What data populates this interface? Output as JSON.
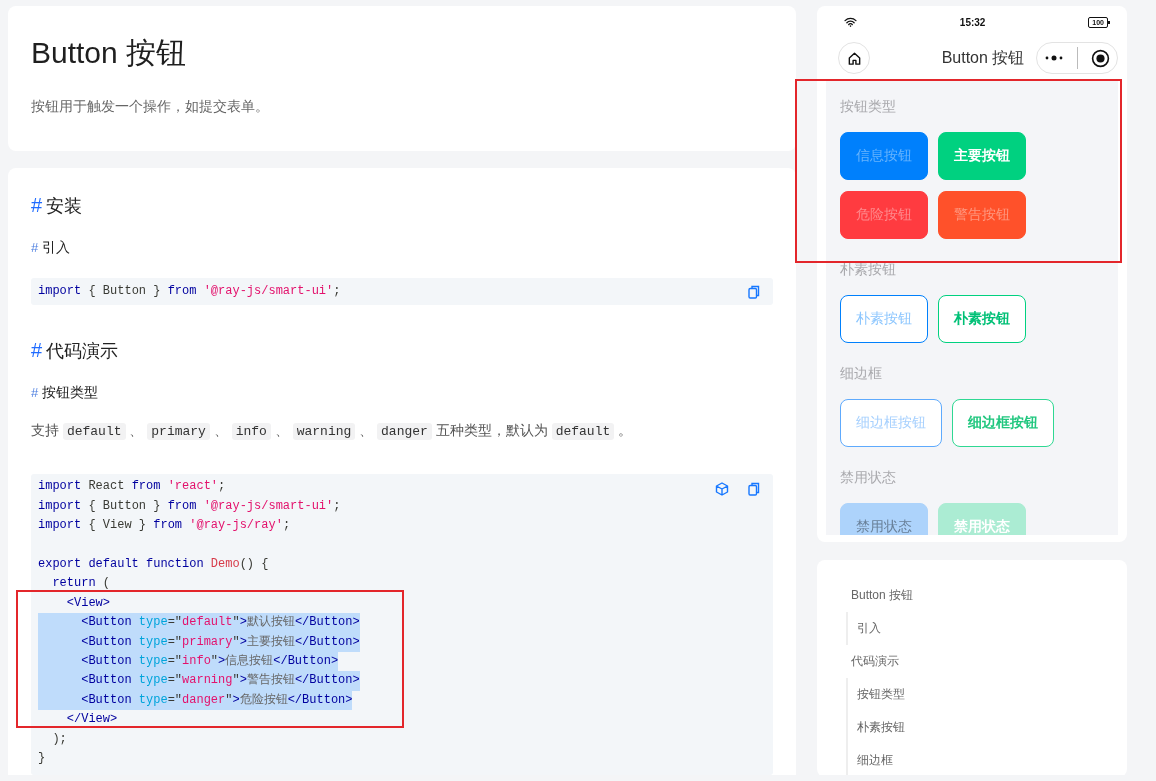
{
  "doc": {
    "title": "Button 按钮",
    "description": "按钮用于触发一个操作，如提交表单。"
  },
  "content": [
    {
      "kind": "h2",
      "anchor": "#",
      "text": "安装"
    },
    {
      "kind": "h3",
      "anchor": "#",
      "text": "引入"
    },
    {
      "kind": "code",
      "actions": [
        {
          "kind": "copy"
        }
      ],
      "lines": [
        {
          "kind": "code",
          "highlighted": false,
          "tokens": [
            {
              "kind": "keyword",
              "text": "import"
            },
            {
              "kind": "plain",
              "text": " { Button } "
            },
            {
              "kind": "keyword",
              "text": "from"
            },
            {
              "kind": "string",
              "text": " '@ray-js/smart-ui'"
            },
            {
              "kind": "plain",
              "text": ";"
            }
          ]
        }
      ]
    },
    {
      "kind": "h2",
      "anchor": "#",
      "text": "代码演示"
    },
    {
      "kind": "h3",
      "anchor": "#",
      "text": "按钮类型"
    },
    {
      "kind": "paragraph",
      "segments": [
        {
          "kind": "text",
          "text": "支持 "
        },
        {
          "kind": "code",
          "text": "default"
        },
        {
          "kind": "text",
          "text": " 、 "
        },
        {
          "kind": "code",
          "text": "primary"
        },
        {
          "kind": "text",
          "text": " 、 "
        },
        {
          "kind": "code",
          "text": "info"
        },
        {
          "kind": "text",
          "text": " 、 "
        },
        {
          "kind": "code",
          "text": "warning"
        },
        {
          "kind": "text",
          "text": " 、 "
        },
        {
          "kind": "code",
          "text": "danger"
        },
        {
          "kind": "text",
          "text": " 五种类型，默认为 "
        },
        {
          "kind": "code",
          "text": "default"
        },
        {
          "kind": "text",
          "text": " 。"
        }
      ]
    },
    {
      "kind": "code",
      "actions": [
        {
          "kind": "sandbox"
        },
        {
          "kind": "copy"
        }
      ],
      "lines": [
        {
          "kind": "code",
          "highlighted": false,
          "tokens": [
            {
              "kind": "keyword",
              "text": "import"
            },
            {
              "kind": "plain",
              "text": " React "
            },
            {
              "kind": "keyword",
              "text": "from"
            },
            {
              "kind": "string",
              "text": " 'react'"
            },
            {
              "kind": "plain",
              "text": ";"
            }
          ]
        },
        {
          "kind": "code",
          "highlighted": false,
          "tokens": [
            {
              "kind": "keyword",
              "text": "import"
            },
            {
              "kind": "plain",
              "text": " { Button } "
            },
            {
              "kind": "keyword",
              "text": "from"
            },
            {
              "kind": "string",
              "text": " '@ray-js/smart-ui'"
            },
            {
              "kind": "plain",
              "text": ";"
            }
          ]
        },
        {
          "kind": "code",
          "highlighted": false,
          "tokens": [
            {
              "kind": "keyword",
              "text": "import"
            },
            {
              "kind": "plain",
              "text": " { View } "
            },
            {
              "kind": "keyword",
              "text": "from"
            },
            {
              "kind": "string",
              "text": " '@ray-js/ray'"
            },
            {
              "kind": "plain",
              "text": ";"
            }
          ]
        },
        {
          "kind": "blank",
          "highlighted": false
        },
        {
          "kind": "code",
          "highlighted": false,
          "tokens": [
            {
              "kind": "keyword",
              "text": "export default function"
            },
            {
              "kind": "func",
              "text": " Demo"
            },
            {
              "kind": "plain",
              "text": "() {"
            }
          ]
        },
        {
          "kind": "code",
          "highlighted": false,
          "tokens": [
            {
              "kind": "keyword",
              "text": "  return"
            },
            {
              "kind": "plain",
              "text": " ("
            }
          ]
        },
        {
          "kind": "code",
          "highlighted": false,
          "tokens": [
            {
              "kind": "tag",
              "text": "    <View>"
            }
          ]
        },
        {
          "kind": "code",
          "highlighted": true,
          "tokens": [
            {
              "kind": "tag",
              "text": "      <Button"
            },
            {
              "kind": "attr",
              "text": " type"
            },
            {
              "kind": "plain",
              "text": "=\""
            },
            {
              "kind": "string",
              "text": "default"
            },
            {
              "kind": "plain",
              "text": "\""
            },
            {
              "kind": "tag",
              "text": ">"
            },
            {
              "kind": "cjk",
              "text": "默认按钮"
            },
            {
              "kind": "tag",
              "text": "</Button>"
            }
          ]
        },
        {
          "kind": "code",
          "highlighted": true,
          "tokens": [
            {
              "kind": "tag",
              "text": "      <Button"
            },
            {
              "kind": "attr",
              "text": " type"
            },
            {
              "kind": "plain",
              "text": "=\""
            },
            {
              "kind": "string",
              "text": "primary"
            },
            {
              "kind": "plain",
              "text": "\""
            },
            {
              "kind": "tag",
              "text": ">"
            },
            {
              "kind": "cjk",
              "text": "主要按钮"
            },
            {
              "kind": "tag",
              "text": "</Button>"
            }
          ]
        },
        {
          "kind": "code",
          "highlighted": true,
          "tokens": [
            {
              "kind": "tag",
              "text": "      <Button"
            },
            {
              "kind": "attr",
              "text": " type"
            },
            {
              "kind": "plain",
              "text": "=\""
            },
            {
              "kind": "string",
              "text": "info"
            },
            {
              "kind": "plain",
              "text": "\""
            },
            {
              "kind": "tag",
              "text": ">"
            },
            {
              "kind": "cjk",
              "text": "信息按钮"
            },
            {
              "kind": "tag",
              "text": "</Button>"
            }
          ]
        },
        {
          "kind": "code",
          "highlighted": true,
          "tokens": [
            {
              "kind": "tag",
              "text": "      <Button"
            },
            {
              "kind": "attr",
              "text": " type"
            },
            {
              "kind": "plain",
              "text": "=\""
            },
            {
              "kind": "string",
              "text": "warning"
            },
            {
              "kind": "plain",
              "text": "\""
            },
            {
              "kind": "tag",
              "text": ">"
            },
            {
              "kind": "cjk",
              "text": "警告按钮"
            },
            {
              "kind": "tag",
              "text": "</Button>"
            }
          ]
        },
        {
          "kind": "code",
          "highlighted": true,
          "tokens": [
            {
              "kind": "tag",
              "text": "      <Button"
            },
            {
              "kind": "attr",
              "text": " type"
            },
            {
              "kind": "plain",
              "text": "=\""
            },
            {
              "kind": "string",
              "text": "danger"
            },
            {
              "kind": "plain",
              "text": "\""
            },
            {
              "kind": "tag",
              "text": ">"
            },
            {
              "kind": "cjk",
              "text": "危险按钮"
            },
            {
              "kind": "tag",
              "text": "</Button>"
            }
          ]
        },
        {
          "kind": "code",
          "highlighted": false,
          "tokens": [
            {
              "kind": "tag",
              "text": "    </View>"
            }
          ]
        },
        {
          "kind": "code",
          "highlighted": false,
          "tokens": [
            {
              "kind": "plain",
              "text": "  );"
            }
          ]
        },
        {
          "kind": "code",
          "highlighted": false,
          "tokens": [
            {
              "kind": "plain",
              "text": "}"
            }
          ]
        }
      ]
    }
  ],
  "preview": {
    "status_bar": {
      "time": "15:32",
      "battery": "100"
    },
    "nav_title": "Button 按钮",
    "sections": [
      {
        "label": "按钮类型",
        "buttons": [
          {
            "label": "信息按钮",
            "kind": "solid",
            "color": "#0080fc",
            "emphasis": false
          },
          {
            "label": "主要按钮",
            "kind": "solid",
            "color": "#00d180",
            "emphasis": true
          },
          {
            "label": "危险按钮",
            "kind": "solid",
            "color": "#ff3b40",
            "emphasis": false
          },
          {
            "label": "警告按钮",
            "kind": "solid",
            "color": "#ff512a",
            "emphasis": false
          }
        ]
      },
      {
        "label": "朴素按钮",
        "buttons": [
          {
            "label": "朴素按钮",
            "kind": "plain",
            "color": "#0080fc",
            "emphasis": false
          },
          {
            "label": "朴素按钮",
            "kind": "plain",
            "color": "#00d180",
            "emphasis": true
          }
        ]
      },
      {
        "label": "细边框",
        "buttons": [
          {
            "label": "细边框按钮",
            "kind": "hairline",
            "color": "#5eaafd",
            "emphasis": false
          },
          {
            "label": "细边框按钮",
            "kind": "hairline",
            "color": "#2fd893",
            "emphasis": true
          }
        ]
      },
      {
        "label": "禁用状态",
        "buttons": [
          {
            "label": "禁用状态",
            "kind": "solid",
            "color": "#add3fb",
            "emphasis": false
          },
          {
            "label": "禁用状态",
            "kind": "solid",
            "color": "#abecd3",
            "emphasis": true
          }
        ]
      }
    ]
  },
  "toc": [
    {
      "text": "Button 按钮",
      "children": [
        {
          "text": "引入"
        }
      ]
    },
    {
      "text": "代码演示",
      "children": [
        {
          "text": "按钮类型"
        },
        {
          "text": "朴素按钮"
        },
        {
          "text": "细边框"
        }
      ]
    }
  ]
}
